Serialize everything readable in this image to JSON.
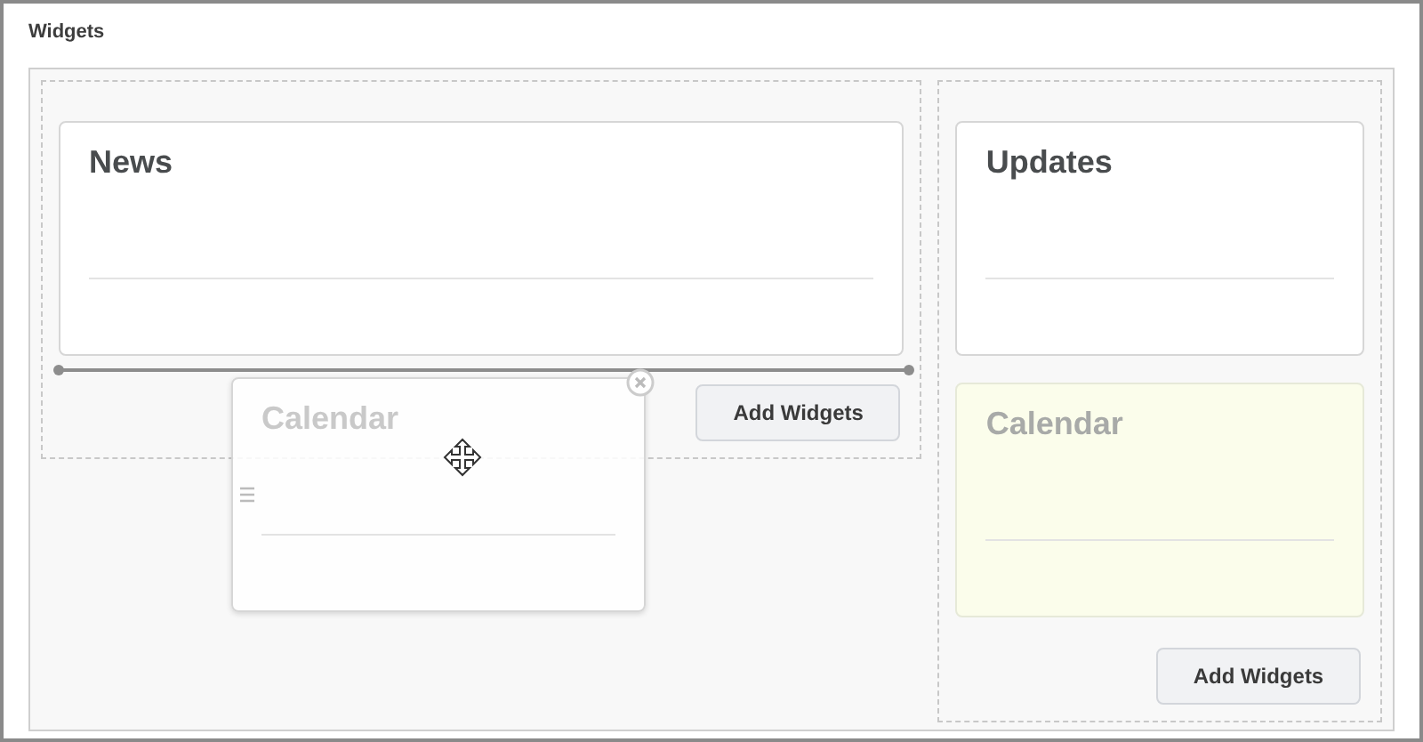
{
  "window": {
    "title": "Widgets"
  },
  "columns": [
    {
      "widgets": [
        {
          "title": "News",
          "kind": "card"
        }
      ],
      "drop_indicator": true,
      "button": "Add Widgets"
    },
    {
      "widgets": [
        {
          "title": "Updates",
          "kind": "card"
        },
        {
          "title": "Calendar",
          "kind": "placeholder"
        }
      ],
      "drop_indicator": false,
      "button": "Add Widgets"
    }
  ],
  "dragged_widget": {
    "title": "Calendar"
  }
}
